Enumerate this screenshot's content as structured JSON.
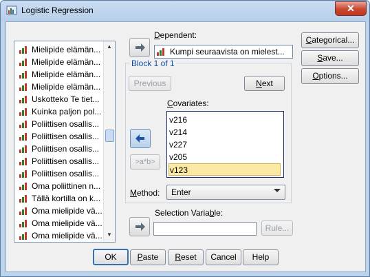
{
  "window": {
    "title": "Logistic Regression",
    "close_label": "✕"
  },
  "variables": [
    "Mielipide elämän...",
    "Mielipide elämän...",
    "Mielipide elämän...",
    "Mielipide elämän...",
    "Uskotteko Te tiet...",
    "Kuinka paljon pol...",
    "Poliittisen osallis...",
    "Poliittisen osallis...",
    "Poliittisen osallis...",
    "Poliittisen osallis...",
    "Poliittisen osallis...",
    "Oma poliittinen n...",
    "Tällä kortilla on k...",
    "Oma mielipide vä...",
    "Oma mielipide vä...",
    "Oma mielipide vä..."
  ],
  "dependent": {
    "label_pre": "",
    "label_u": "D",
    "label_post": "ependent:",
    "value": "Kumpi seuraavista on mielest..."
  },
  "block": {
    "title": "Block 1 of 1",
    "previous": "Previous",
    "next_u": "N",
    "next_post": "ext"
  },
  "covariates": {
    "label_u": "C",
    "label_post": "ovariates:",
    "items": [
      "v216",
      "v214",
      "v227",
      "v205",
      "v123"
    ],
    "selected_index": 4
  },
  "interaction_label": ">a*b>",
  "method": {
    "label_u": "M",
    "label_post": "ethod:",
    "value": "Enter"
  },
  "selection": {
    "label_pre": "Selection Varia",
    "label_u": "b",
    "label_post": "le:",
    "value": "",
    "rule": "Rule..."
  },
  "side_buttons": {
    "categorical": {
      "pre": "",
      "u": "C",
      "post": "ategorical..."
    },
    "save": {
      "pre": "",
      "u": "S",
      "post": "ave..."
    },
    "options": {
      "pre": "",
      "u": "O",
      "post": "ptions..."
    }
  },
  "bottom_buttons": {
    "ok": "OK",
    "paste": {
      "u": "P",
      "post": "aste"
    },
    "reset": {
      "u": "R",
      "post": "eset"
    },
    "cancel": "Cancel",
    "help": "Help"
  }
}
